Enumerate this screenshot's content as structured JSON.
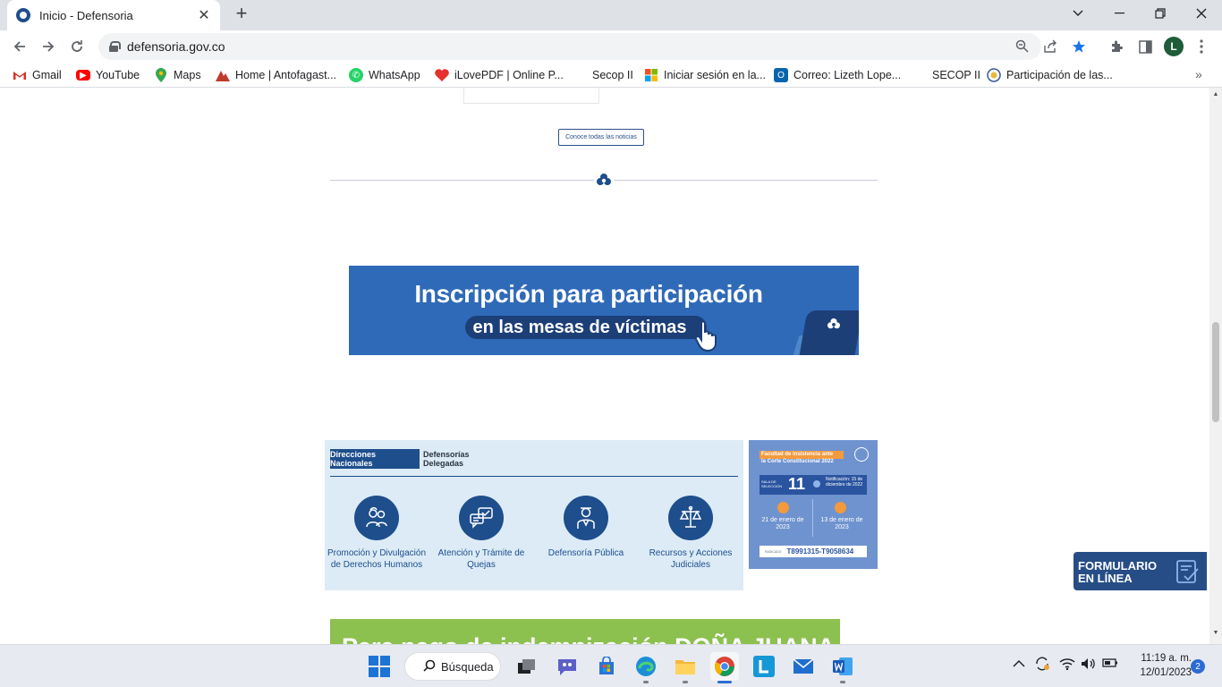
{
  "browser": {
    "tab_title": "Inicio - Defensoria",
    "url": "defensoria.gov.co",
    "profile_initial": "L",
    "bookmarks": [
      {
        "label": "Gmail",
        "icon": "gmail-icon",
        "color": "#d93025"
      },
      {
        "label": "YouTube",
        "icon": "youtube-icon",
        "color": "#ff0000"
      },
      {
        "label": "Maps",
        "icon": "maps-icon",
        "color": "#34a853"
      },
      {
        "label": "Home | Antofagast...",
        "icon": "antofagasta-icon",
        "color": "#c0392b"
      },
      {
        "label": "WhatsApp",
        "icon": "whatsapp-icon",
        "color": "#25d366"
      },
      {
        "label": "iLovePDF | Online P...",
        "icon": "ilovepdf-icon",
        "color": "#e5322d"
      },
      {
        "label": "Secop II",
        "icon": "",
        "color": ""
      },
      {
        "label": "Iniciar sesión en la...",
        "icon": "microsoft-icon",
        "color": "#f25022"
      },
      {
        "label": "Correo: Lizeth Lope...",
        "icon": "outlook-icon",
        "color": "#0a64ad"
      },
      {
        "label": "SECOP II",
        "icon": "",
        "color": ""
      },
      {
        "label": "Participación de las...",
        "icon": "colombia-seal-icon",
        "color": "#3b5a8f"
      }
    ]
  },
  "page": {
    "news_button": "Conoce todas las noticias",
    "banner": {
      "line1": "Inscripción para participación",
      "line2": "en las mesas de víctimas"
    },
    "services": {
      "tabs": [
        "Direcciones Nacionales",
        "Defensorías Delegadas"
      ],
      "items": [
        {
          "label": "Promoción y Divulgación de Derechos Humanos",
          "icon": "people-icon"
        },
        {
          "label": "Atención y Trámite de Quejas",
          "icon": "chat-check-icon"
        },
        {
          "label": "Defensoría Pública",
          "icon": "person-lawyer-icon"
        },
        {
          "label": "Recursos y Acciones Judiciales",
          "icon": "scales-icon"
        }
      ]
    },
    "notice": {
      "heading": "Facultad de insistencia ante",
      "subheading": "la Corte Constitucional 2022",
      "sala_label": "SALA DE SELECCIÓN",
      "sala_number": "11",
      "notificacion": "Notificación: 15 de diciembre de 2022",
      "date_left": "21 de enero de 2023",
      "date_right": "13 de enero de 2023",
      "rad_label": "RADICADO",
      "rad_value": "T8991315-T9058634"
    },
    "form_badge": {
      "line1": "FORMULARIO",
      "line2": "EN LÍNEA"
    },
    "green_banner": "Para pago de indemnización DOÑA JUANA"
  },
  "taskbar": {
    "search_label": "Búsqueda",
    "time": "11:19 a. m.",
    "date": "12/01/2023",
    "notifications": "2"
  },
  "colors": {
    "brand_blue": "#1e4e8c",
    "banner_blue": "#2f6ab8",
    "green": "#8cc04f"
  }
}
